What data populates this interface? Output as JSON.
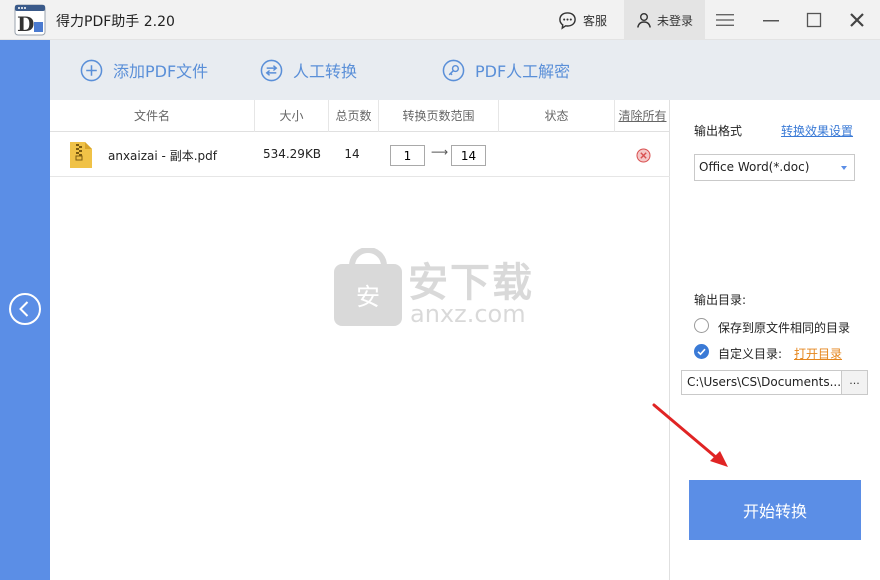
{
  "window": {
    "title": "得力PDF助手 2.20",
    "service_label": "客服",
    "login_label": "未登录"
  },
  "toolbar": {
    "add_pdf": "添加PDF文件",
    "manual_convert": "人工转换",
    "pdf_decrypt": "PDF人工解密"
  },
  "table": {
    "headers": {
      "filename": "文件名",
      "size": "大小",
      "pages": "总页数",
      "range": "转换页数范围",
      "status": "状态",
      "clear": "清除所有"
    },
    "rows": [
      {
        "name": "anxaizai - 副本.pdf",
        "size": "534.29KB",
        "pages": "14",
        "from": "1",
        "to": "14"
      }
    ]
  },
  "watermark": {
    "brand": "安下载",
    "domain": "anxz.com"
  },
  "settings": {
    "format_label": "输出格式",
    "effect_link": "转换效果设置",
    "format_value": "Office Word(*.doc)",
    "outdir_label": "输出目录:",
    "opt_same": "保存到原文件相同的目录",
    "opt_custom": "自定义目录:",
    "open_dir": "打开目录",
    "path": "C:\\Users\\CS\\Documents...",
    "browse": "...",
    "start": "开始转换"
  },
  "colors": {
    "accent": "#5b8ee6",
    "link": "#3a7ad6",
    "orange_link": "#e5861d",
    "toolbar_bg": "#e8ecf1"
  }
}
